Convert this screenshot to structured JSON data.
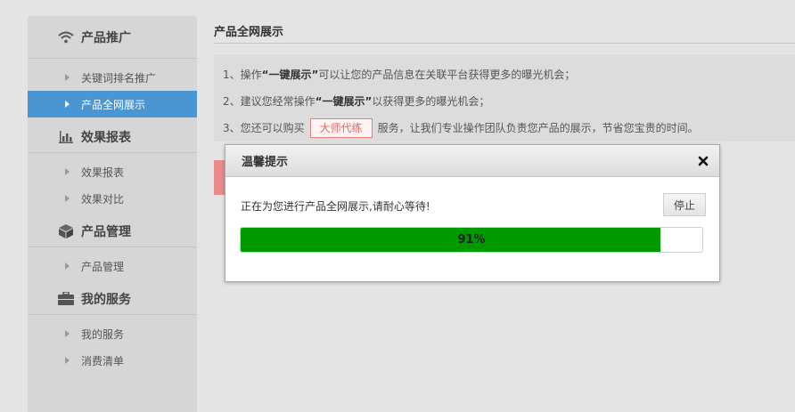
{
  "sidebar": {
    "groups": [
      {
        "title": "产品推广",
        "icon": "wifi-icon",
        "items": [
          {
            "label": "关键词排名推广",
            "active": false
          },
          {
            "label": "产品全网展示",
            "active": true
          }
        ]
      },
      {
        "title": "效果报表",
        "icon": "bar-chart-icon",
        "items": [
          {
            "label": "效果报表",
            "active": false
          },
          {
            "label": "效果对比",
            "active": false
          }
        ]
      },
      {
        "title": "产品管理",
        "icon": "box-icon",
        "items": [
          {
            "label": "产品管理",
            "active": false
          }
        ]
      },
      {
        "title": "我的服务",
        "icon": "briefcase-icon",
        "items": [
          {
            "label": "我的服务",
            "active": false
          },
          {
            "label": "消费清单",
            "active": false
          }
        ]
      }
    ]
  },
  "main": {
    "title": "产品全网展示",
    "notice": {
      "line1_prefix": "1、操作",
      "line1_bold": "“一键展示”",
      "line1_suffix": "可以让您的产品信息在关联平台获得更多的曝光机会；",
      "line2_prefix": "2、建议您经常操作",
      "line2_bold": "“一键展示”",
      "line2_suffix": "以获得更多的曝光机会；",
      "line3_prefix": "3、您还可以购买",
      "line3_button": "大师代练",
      "line3_suffix": "服务，让我们专业操作团队负责您产品的展示，节省您宝贵的时间。"
    }
  },
  "dialog": {
    "title": "温馨提示",
    "close_icon": "close-icon",
    "message": "正在为您进行产品全网展示,请耐心等待!",
    "stop_label": "停止",
    "progress_percent": 91,
    "progress_text": "91%",
    "progress_color": "#009900"
  },
  "colors": {
    "active_item": "#4a96d2",
    "sidebar_bg": "#d6d6d6",
    "page_bg": "#e4e4e4",
    "accent_red": "#e06a6a"
  }
}
